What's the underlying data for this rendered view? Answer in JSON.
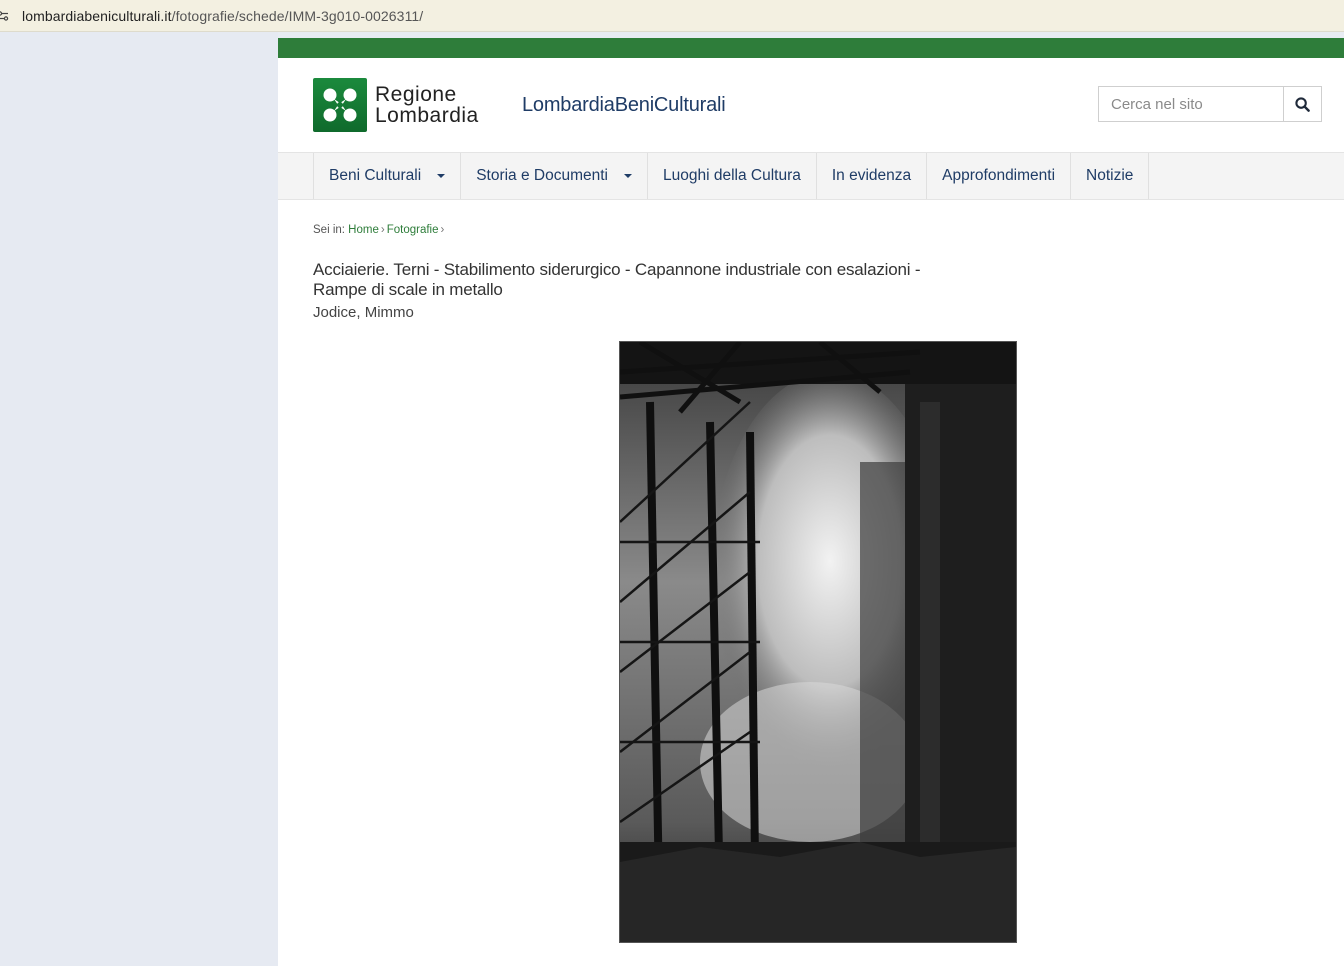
{
  "browser": {
    "url_domain": "lombardiabeniculturali.it",
    "url_path": "/fotografie/schede/IMM-3g010-0026311/"
  },
  "header": {
    "logo_line1": "Regione",
    "logo_line2": "Lombardia",
    "site_name": "LombardiaBeniCulturali",
    "search_placeholder": "Cerca nel sito",
    "search_icon": "search-icon",
    "brand_green": "#2e7d3a",
    "brand_blue": "#1f3c66"
  },
  "nav": {
    "items": [
      {
        "label": "Beni Culturali",
        "has_dropdown": true
      },
      {
        "label": "Storia e Documenti",
        "has_dropdown": true
      },
      {
        "label": "Luoghi della Cultura",
        "has_dropdown": false
      },
      {
        "label": "In evidenza",
        "has_dropdown": false
      },
      {
        "label": "Approfondimenti",
        "has_dropdown": false
      },
      {
        "label": "Notizie",
        "has_dropdown": false
      }
    ]
  },
  "breadcrumb": {
    "prefix": "Sei in:",
    "items": [
      "Home",
      "Fotografie"
    ],
    "separator": "›"
  },
  "record": {
    "title": "Acciaierie. Terni - Stabilimento siderurgico - Capannone industriale con esalazioni - Rampe di scale in metallo",
    "author": "Jodice, Mimmo"
  }
}
